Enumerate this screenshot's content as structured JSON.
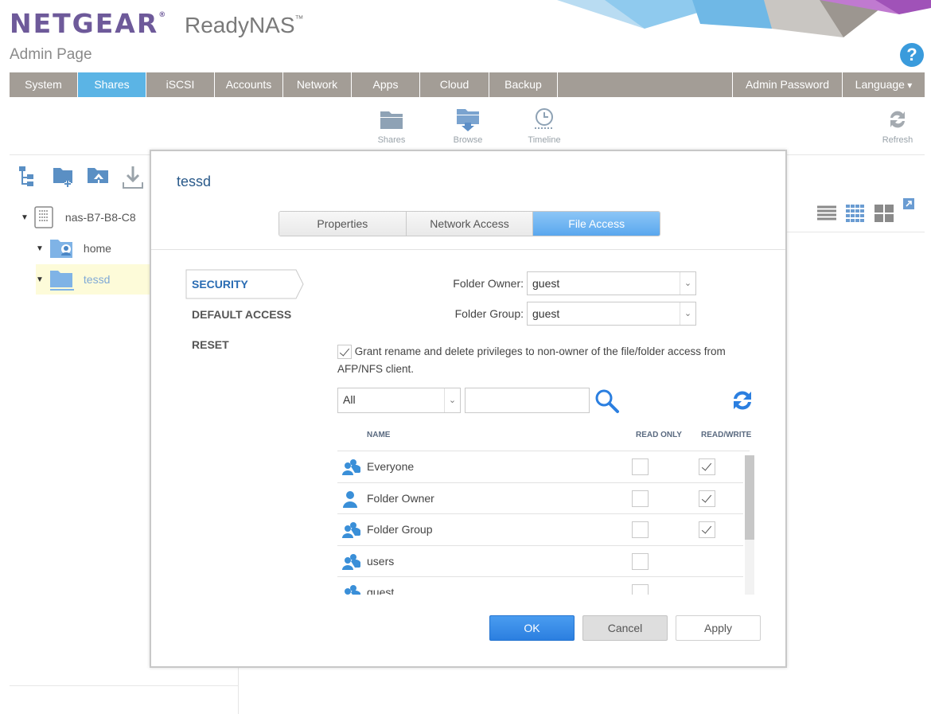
{
  "brand": {
    "logo": "NETGEAR",
    "logo_mark": "®",
    "product": "ReadyNAS",
    "product_mark": "™",
    "subtitle": "Admin Page"
  },
  "nav": {
    "items": [
      {
        "label": "System",
        "active": false
      },
      {
        "label": "Shares",
        "active": true
      },
      {
        "label": "iSCSI",
        "active": false
      },
      {
        "label": "Accounts",
        "active": false
      },
      {
        "label": "Network",
        "active": false
      },
      {
        "label": "Apps",
        "active": false
      },
      {
        "label": "Cloud",
        "active": false
      },
      {
        "label": "Backup",
        "active": false
      }
    ],
    "admin_password": "Admin Password",
    "language": "Language"
  },
  "toolbar": {
    "shares": "Shares",
    "browse": "Browse",
    "timeline": "Timeline",
    "refresh": "Refresh"
  },
  "tree": {
    "device": "nas-B7-B8-C8",
    "home": "home",
    "tessd": "tessd"
  },
  "dialog": {
    "title": "tessd",
    "tabs": [
      {
        "label": "Properties",
        "active": false
      },
      {
        "label": "Network Access",
        "active": false
      },
      {
        "label": "File Access",
        "active": true
      }
    ],
    "side_menu": [
      {
        "label": "SECURITY",
        "active": true
      },
      {
        "label": "DEFAULT ACCESS",
        "active": false
      },
      {
        "label": "RESET",
        "active": false
      }
    ],
    "folder_owner_label": "Folder Owner:",
    "folder_owner_value": "guest",
    "folder_group_label": "Folder Group:",
    "folder_group_value": "guest",
    "grant_checked": true,
    "grant_text": "Grant rename and delete privileges to non-owner of the file/folder access from AFP/NFS client.",
    "filter_value": "All",
    "search_value": "",
    "columns": {
      "name": "NAME",
      "read_only": "READ ONLY",
      "read_write": "READ/WRITE"
    },
    "rows": [
      {
        "name": "Everyone",
        "icon": "group-icon",
        "read_only": false,
        "read_write": true
      },
      {
        "name": "Folder Owner",
        "icon": "user-icon",
        "read_only": false,
        "read_write": true
      },
      {
        "name": "Folder Group",
        "icon": "group-icon",
        "read_only": false,
        "read_write": true
      },
      {
        "name": "users",
        "icon": "group-icon",
        "read_only": false,
        "read_write": false
      },
      {
        "name": "guest",
        "icon": "group-icon",
        "read_only": false,
        "read_write": false
      }
    ],
    "buttons": {
      "ok": "OK",
      "cancel": "Cancel",
      "apply": "Apply"
    }
  },
  "colors": {
    "brand_purple": "#6e5a9a",
    "nav_bg": "#a39d96",
    "nav_active": "#5bb4e5",
    "accent_blue": "#2b7fe0",
    "icon_blue": "#3a8fd8"
  }
}
